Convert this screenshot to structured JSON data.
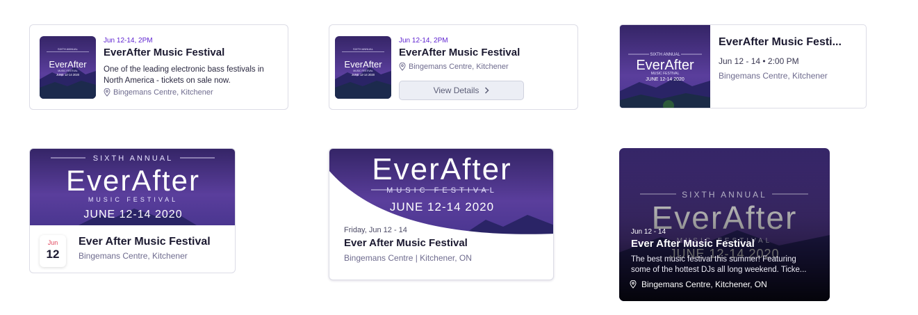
{
  "art": {
    "sixth_annual": "SIXTH ANNUAL",
    "logo": "EverAfter",
    "music_festival": "MUSIC FESTIVAL",
    "dates": "JUNE 12-14 2020"
  },
  "cards": {
    "c1": {
      "date": "Jun 12-14, 2PM",
      "title": "EverAfter Music Festival",
      "desc_line1": "One of the leading electronic bass festivals in",
      "desc_line2": "North America - tickets on sale now.",
      "location": "Bingemans Centre, Kitchener"
    },
    "c2": {
      "date": "Jun 12-14, 2PM",
      "title": "EverAfter Music Festival",
      "location": "Bingemans Centre, Kitchener",
      "button_label": "View Details"
    },
    "c3": {
      "title": "EverAfter Music Festi...",
      "datetime": "Jun 12 - 14 • 2:00 PM",
      "location": "Bingemans Centre, Kitchener"
    },
    "c4": {
      "cal_month": "Jun",
      "cal_day": "12",
      "title": "Ever After Music Festival",
      "location": "Bingemans Centre, Kitchener"
    },
    "c5": {
      "date": "Friday, Jun 12 - 14",
      "title": "Ever After Music Festival",
      "location": "Bingemans Centre | Kitchener, ON"
    },
    "c6": {
      "date": "Jun 12 - 14",
      "title": "Ever After Music Festival",
      "desc_line1": "The best music festival this summer! Featuring",
      "desc_line2": "some of the hottest DJs all long weekend. Ticke...",
      "location": "Bingemans Centre, Kitchener, ON"
    }
  },
  "icons": [
    "location-pin-icon",
    "chevron-right-icon"
  ],
  "colors": {
    "accent_purple": "#5b1ecf",
    "art_bg_top": "#3b2873",
    "art_bg_bottom": "#5b3f9e",
    "mountain": "#2a2466",
    "calendar_month": "#e0465c"
  }
}
